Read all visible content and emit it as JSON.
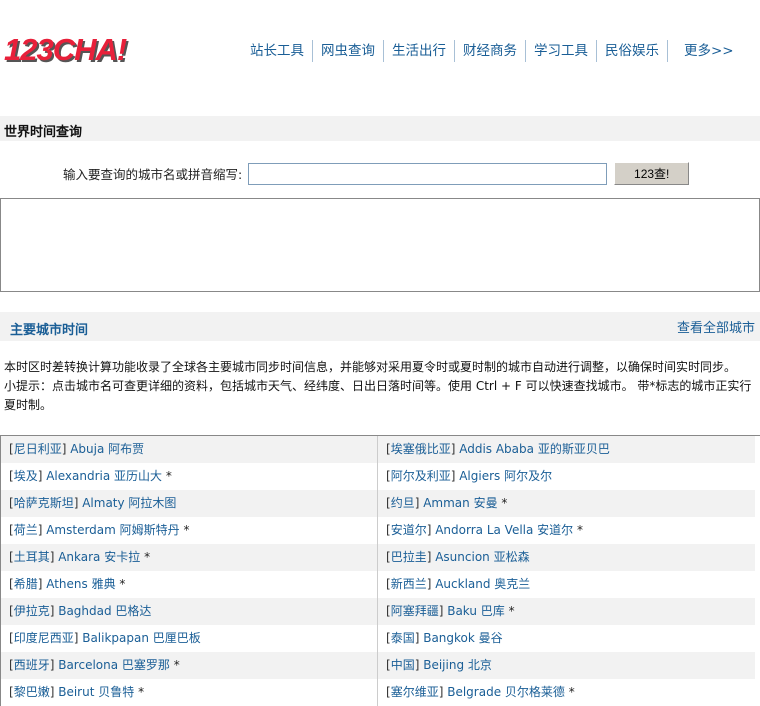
{
  "logo": "123CHA!",
  "nav": [
    "站长工具",
    "网虫查询",
    "生活出行",
    "财经商务",
    "学习工具",
    "民俗娱乐",
    "更多>>"
  ],
  "section1": {
    "title": "世界时间查询",
    "label": "输入要查询的城市名或拼音缩写:",
    "input_value": "",
    "button": "123查!"
  },
  "section2": {
    "title": "主要城市时间",
    "view_all": "查看全部城市",
    "intro1": "本时区时差转换计算功能收录了全球各主要城市同步时间信息，并能够对采用夏令时或夏时制的城市自动进行调整，以确保时间实时同步。",
    "intro2": "小提示：点击城市名可查更详细的资料，包括城市天气、经纬度、日出日落时间等。使用 Ctrl + F 可以快速查找城市。 带*标志的城市正实行夏时制。"
  },
  "cities": [
    {
      "country": "尼日利亚",
      "city": "Abuja 阿布贾",
      "dst": false
    },
    {
      "country": "埃塞俄比亚",
      "city": "Addis Ababa 亚的斯亚贝巴",
      "dst": false
    },
    {
      "country": "埃及",
      "city": "Alexandria 亚历山大",
      "dst": true
    },
    {
      "country": "阿尔及利亚",
      "city": "Algiers 阿尔及尔",
      "dst": false
    },
    {
      "country": "哈萨克斯坦",
      "city": "Almaty 阿拉木图",
      "dst": false
    },
    {
      "country": "约旦",
      "city": "Amman 安曼",
      "dst": true
    },
    {
      "country": "荷兰",
      "city": "Amsterdam 阿姆斯特丹",
      "dst": true
    },
    {
      "country": "安道尔",
      "city": "Andorra La Vella 安道尔",
      "dst": true
    },
    {
      "country": "土耳其",
      "city": "Ankara 安卡拉",
      "dst": true
    },
    {
      "country": "巴拉圭",
      "city": "Asuncion 亚松森",
      "dst": false
    },
    {
      "country": "希腊",
      "city": "Athens 雅典",
      "dst": true
    },
    {
      "country": "新西兰",
      "city": "Auckland 奥克兰",
      "dst": false
    },
    {
      "country": "伊拉克",
      "city": "Baghdad 巴格达",
      "dst": false
    },
    {
      "country": "阿塞拜疆",
      "city": "Baku 巴库",
      "dst": true
    },
    {
      "country": "印度尼西亚",
      "city": "Balikpapan 巴厘巴板",
      "dst": false
    },
    {
      "country": "泰国",
      "city": "Bangkok 曼谷",
      "dst": false
    },
    {
      "country": "西班牙",
      "city": "Barcelona 巴塞罗那",
      "dst": true
    },
    {
      "country": "中国",
      "city": "Beijing 北京",
      "dst": false
    },
    {
      "country": "黎巴嫩",
      "city": "Beirut 贝鲁特",
      "dst": true
    },
    {
      "country": "塞尔维亚",
      "city": "Belgrade 贝尔格莱德",
      "dst": true
    }
  ],
  "dst_mark": "*"
}
